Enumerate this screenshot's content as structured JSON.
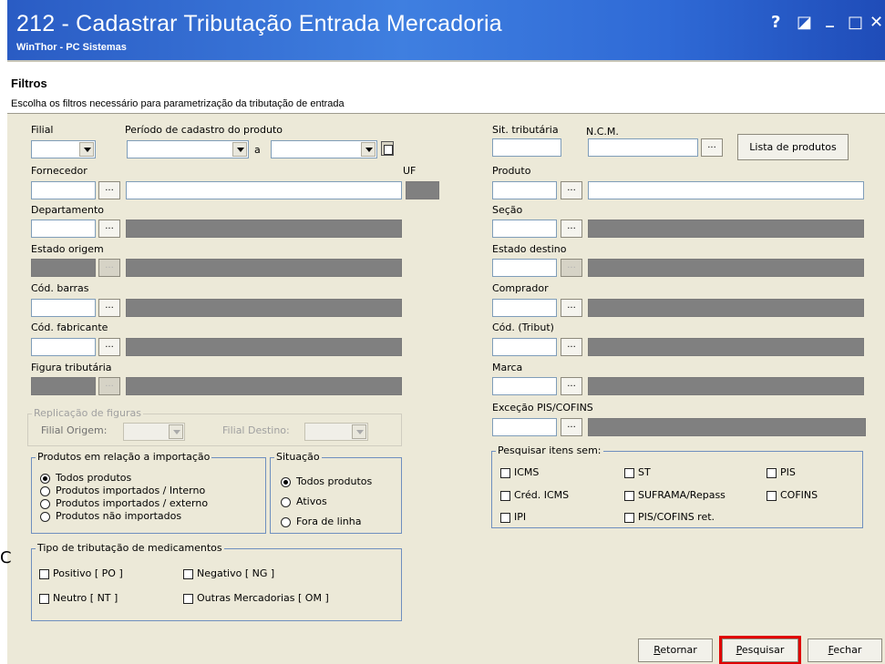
{
  "window": {
    "title": "212 - Cadastrar Tributação Entrada Mercadoria",
    "subtitle": "WinThor - PC Sistemas",
    "controls": [
      "?",
      "◪",
      "_",
      "□",
      "✕"
    ]
  },
  "header": {
    "title": "Filtros",
    "description": "Escolha os filtros necessário para parametrização da tributação de entrada"
  },
  "left": {
    "filial": "Filial",
    "periodo": "Período de cadastro do produto",
    "a": "a",
    "fornecedor": "Fornecedor",
    "uf": "UF",
    "departamento": "Departamento",
    "estado_origem": "Estado origem",
    "cod_barras": "Cód. barras",
    "cod_fabricante": "Cód. fabricante",
    "figura": "Figura tributária",
    "replicacao": {
      "title": "Replicação de figuras",
      "origem": "Filial Origem:",
      "destino": "Filial Destino:"
    },
    "produtos": {
      "title": "Produtos em relação a importação",
      "options": [
        "Todos produtos",
        "Produtos importados / Interno",
        "Produtos importados / externo",
        "Produtos não importados"
      ]
    },
    "situacao": {
      "title": "Situação",
      "options": [
        "Todos produtos",
        "Ativos",
        "Fora de linha"
      ]
    },
    "medicamentos": {
      "title": "Tipo de tributação de medicamentos",
      "items": [
        "Positivo [ PO ]",
        "Negativo [ NG ]",
        "Neutro [ NT ]",
        "Outras Mercadorias [ OM ]"
      ]
    }
  },
  "right": {
    "sit": "Sit. tributária",
    "ncm": "N.C.M.",
    "lista": "Lista de produtos",
    "produto": "Produto",
    "secao": "Seção",
    "estado_destino": "Estado destino",
    "comprador": "Comprador",
    "cod_tribut": "Cód. (Tribut)",
    "marca": "Marca",
    "excecao": "Exceção PIS/COFINS",
    "pesquisar": {
      "title": "Pesquisar itens sem:",
      "items": [
        "ICMS",
        "ST",
        "PIS",
        "Créd. ICMS",
        "SUFRAMA/Repass",
        "COFINS",
        "IPI",
        "PIS/COFINS ret."
      ]
    }
  },
  "ellipsis": "...",
  "buttons": {
    "retornar_u": "R",
    "retornar": "etornar",
    "pesquisar_u": "P",
    "pesquisar": "esquisar",
    "fechar_u": "F",
    "fechar": "echar"
  },
  "stray": "C",
  "colors": {
    "title_bg": "#2f6ad6",
    "form_bg": "#ece9d8",
    "highlight": "#e00000"
  }
}
